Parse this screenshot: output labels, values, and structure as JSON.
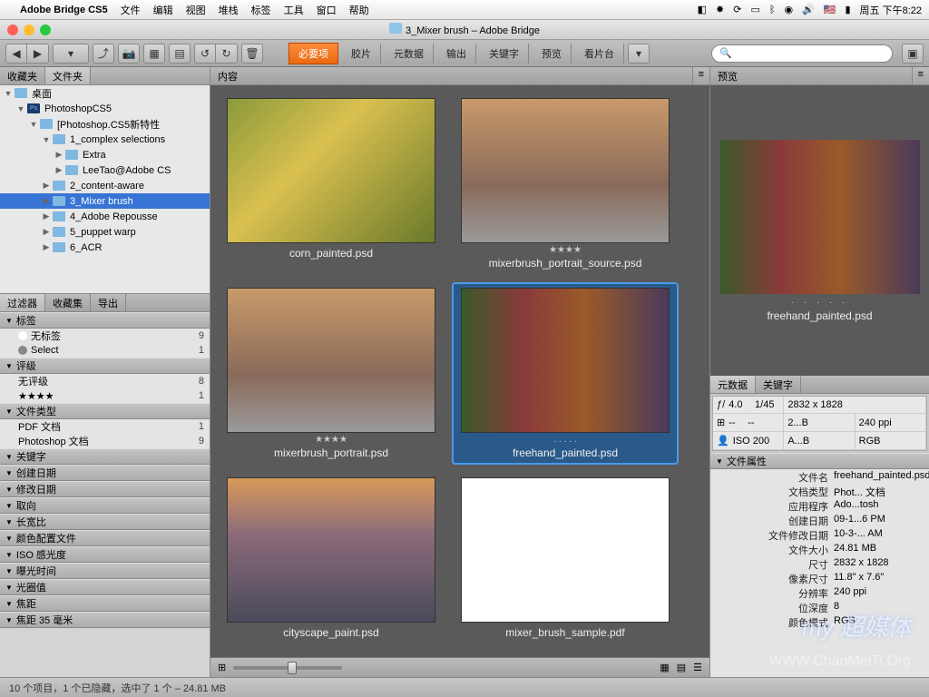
{
  "menubar": {
    "apple": "",
    "app": "Adobe Bridge CS5",
    "items": [
      "文件",
      "编辑",
      "视图",
      "堆栈",
      "标签",
      "工具",
      "窗口",
      "帮助"
    ],
    "clock": "周五 下午8:22"
  },
  "window": {
    "title": "3_Mixer brush – Adobe Bridge"
  },
  "toolbar": {
    "search_placeholder": ""
  },
  "centerTabs": [
    "内容",
    "必要项",
    "胶片",
    "元数据",
    "输出",
    "关键字",
    "预览",
    "看片台"
  ],
  "leftTabs": {
    "fav": "收藏夹",
    "folders": "文件夹"
  },
  "tree": [
    {
      "indent": 0,
      "open": true,
      "icon": "desktop",
      "label": "桌面"
    },
    {
      "indent": 1,
      "open": true,
      "icon": "ps",
      "label": "PhotoshopCS5"
    },
    {
      "indent": 2,
      "open": true,
      "icon": "folder",
      "label": "[Photoshop.CS5新特性"
    },
    {
      "indent": 3,
      "open": true,
      "icon": "folder",
      "label": "1_complex selections"
    },
    {
      "indent": 4,
      "open": false,
      "icon": "folder",
      "label": "Extra"
    },
    {
      "indent": 4,
      "open": false,
      "icon": "folder",
      "label": "LeeTao@Adobe CS"
    },
    {
      "indent": 3,
      "open": false,
      "icon": "folder",
      "label": "2_content-aware"
    },
    {
      "indent": 3,
      "open": false,
      "icon": "folder",
      "label": "3_Mixer brush",
      "sel": true
    },
    {
      "indent": 3,
      "open": false,
      "icon": "folder",
      "label": "4_Adobe Repousse"
    },
    {
      "indent": 3,
      "open": false,
      "icon": "folder",
      "label": "5_puppet warp"
    },
    {
      "indent": 3,
      "open": false,
      "icon": "folder",
      "label": "6_ACR"
    }
  ],
  "filterTabs": [
    "过滤器",
    "收藏集",
    "导出"
  ],
  "filters": {
    "label_head": "标签",
    "labels": [
      {
        "name": "无标签",
        "count": "9"
      },
      {
        "name": "Select",
        "count": "1"
      }
    ],
    "rating_head": "评级",
    "ratings": [
      {
        "name": "无评级",
        "count": "8"
      },
      {
        "name": "★★★★",
        "count": "1"
      }
    ],
    "ftype_head": "文件类型",
    "ftypes": [
      {
        "name": "PDF 文档",
        "count": "1"
      },
      {
        "name": "Photoshop 文档",
        "count": "9"
      }
    ],
    "heads": [
      "关键字",
      "创建日期",
      "修改日期",
      "取向",
      "长宽比",
      "颜色配置文件",
      "ISO 感光度",
      "曝光时间",
      "光圈值",
      "焦距",
      "焦距 35 毫米"
    ]
  },
  "thumbs": [
    {
      "name": "corn_painted.psd",
      "stars": "",
      "cls": "thumb-corn"
    },
    {
      "name": "mixerbrush_portrait_source.psd",
      "stars": "★★★★",
      "cls": "thumb-portrait"
    },
    {
      "name": "mixerbrush_portrait.psd",
      "stars": "★★★★",
      "cls": "thumb-portrait"
    },
    {
      "name": "freehand_painted.psd",
      "stars": ". . . . .",
      "cls": "thumb-free",
      "sel": true
    },
    {
      "name": "cityscape_paint.psd",
      "stars": "",
      "cls": "thumb-city",
      "wide": false
    },
    {
      "name": "mixer_brush_sample.pdf",
      "stars": "",
      "cls": "thumb-pdf",
      "wide": false
    }
  ],
  "preview": {
    "tab": "预览",
    "label": "freehand_painted.psd",
    "dots": "· · · · ·"
  },
  "metaTabs": [
    "元数据",
    "关键字"
  ],
  "metaGrid": [
    [
      "ƒ/",
      "4.0",
      "1/45"
    ],
    [
      "",
      "2832 x 1828",
      ""
    ],
    [
      "⊞",
      "--",
      "--"
    ],
    [
      "",
      "2...B",
      "240 ppi"
    ],
    [
      "👤",
      "ISO 200",
      ""
    ],
    [
      "",
      "A...B",
      "RGB"
    ]
  ],
  "propsHead": "文件属性",
  "props": [
    {
      "k": "文件名",
      "v": "freehand_painted.psd"
    },
    {
      "k": "文档类型",
      "v": "Phot... 文档"
    },
    {
      "k": "应用程序",
      "v": "Ado...tosh"
    },
    {
      "k": "创建日期",
      "v": "09-1...6 PM"
    },
    {
      "k": "文件修改日期",
      "v": "10-3-... AM"
    },
    {
      "k": "文件大小",
      "v": "24.81 MB"
    },
    {
      "k": "尺寸",
      "v": "2832 x 1828"
    },
    {
      "k": "像素尺寸",
      "v": "11.8\" x 7.6\""
    },
    {
      "k": "分辨率",
      "v": "240 ppi"
    },
    {
      "k": "位深度",
      "v": "8"
    },
    {
      "k": "颜色模式",
      "v": "RGB"
    }
  ],
  "status": "10 个项目，1 个已隐藏，选中了 1 个 – 24.81 MB",
  "watermark": "my 超媒体",
  "watermark2": "WWW.ChaoMeiTi.Org"
}
